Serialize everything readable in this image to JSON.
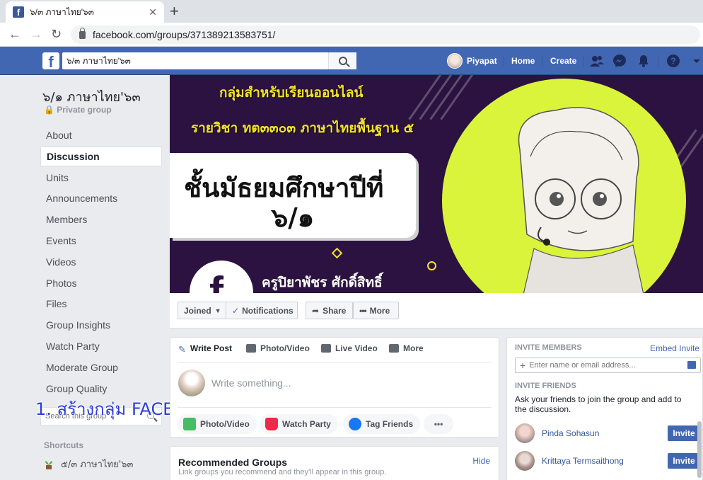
{
  "browser": {
    "tab_title": "๖/๓ ภาษาไทย'๖๓",
    "tab_close": "✕",
    "new_tab": "+",
    "url": "facebook.com/groups/371389213583751/"
  },
  "fb_header": {
    "logo": "f",
    "search_value": "๖/๓ ภาษาไทย'๖๓",
    "user_name": "Piyapat",
    "home": "Home",
    "create": "Create"
  },
  "cover": {
    "line1": "กลุ่มสำหรับเรียนออนไลน์",
    "line2": "รายวิชา ทต๓๓๐๓ ภาษาไทยพื้นฐาน ๕",
    "card_line1": "ชั้นมัธยมศึกษาปีที่",
    "card_line2": "๖/๑",
    "fb_letter": "f",
    "teacher": "ครูปิยาพัชร ศักดิ์สิทธิ์",
    "circle_color": "#d9f43a",
    "bg_color": "#2b1240"
  },
  "actions": {
    "joined": "Joined",
    "notifications": "Notifications",
    "share": "Share",
    "more": "More"
  },
  "sidebar": {
    "group_name": "๖/๑ ภาษาไทย'๖๓",
    "privacy": "Private group",
    "items": [
      {
        "label": "About"
      },
      {
        "label": "Discussion",
        "active": true
      },
      {
        "label": "Units"
      },
      {
        "label": "Announcements"
      },
      {
        "label": "Members"
      },
      {
        "label": "Events"
      },
      {
        "label": "Videos"
      },
      {
        "label": "Photos"
      },
      {
        "label": "Files"
      },
      {
        "label": "Group Insights"
      },
      {
        "label": "Watch Party"
      },
      {
        "label": "Moderate Group"
      },
      {
        "label": "Group Quality"
      }
    ],
    "search_placeholder": "Search this group",
    "overlay_text": "1. สร้างกลุ่ม FACEBOOK",
    "shortcuts_label": "Shortcuts",
    "shortcut_item": "๕/๓ ภาษาไทย'๖๓"
  },
  "composer": {
    "tabs": [
      "Write Post",
      "Photo/Video",
      "Live Video",
      "More"
    ],
    "placeholder": "Write something...",
    "pills": [
      "Photo/Video",
      "Watch Party",
      "Tag Friends"
    ],
    "more_dots": "•••"
  },
  "recommended": {
    "title": "Recommended Groups",
    "subtitle": "Link groups you recommend and they'll appear in this group.",
    "hide": "Hide"
  },
  "invite": {
    "members_label": "INVITE MEMBERS",
    "embed": "Embed Invite",
    "input_placeholder": "Enter name or email address...",
    "friends_label": "INVITE FRIENDS",
    "description": "Ask your friends to join the group and add to the discussion.",
    "friends": [
      {
        "name": "Pinda Sohasun",
        "button": "Invite"
      },
      {
        "name": "Krittaya Termsaithong",
        "button": "Invite"
      }
    ]
  }
}
